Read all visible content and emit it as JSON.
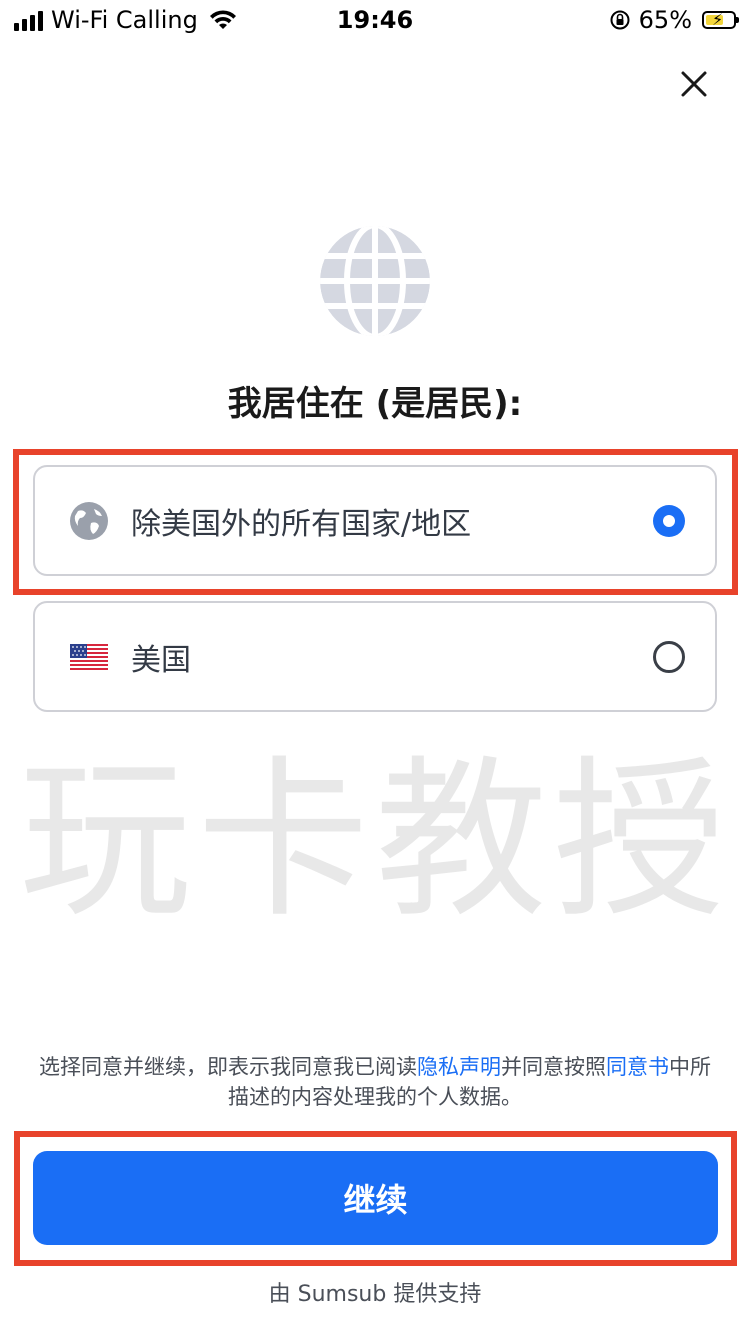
{
  "status_bar": {
    "carrier": "Wi-Fi Calling",
    "time": "19:46",
    "battery_percent": "65%",
    "battery_level": 0.65,
    "icons": [
      "signal-icon",
      "wifi-icon",
      "orientation-lock-icon",
      "battery-charging-icon"
    ]
  },
  "header": {
    "close_icon": "close-icon"
  },
  "hero": {
    "icon": "globe-icon",
    "title": "我居住在 (是居民):"
  },
  "options": [
    {
      "label": "除美国外的所有国家/地区",
      "icon": "globe-icon",
      "selected": true
    },
    {
      "label": "美国",
      "icon": "us-flag-icon",
      "selected": false
    }
  ],
  "watermark": "玩卡教授",
  "consent": {
    "text_before": "选择同意并继续，即表示我同意我已阅读",
    "privacy_link": "隐私声明",
    "text_middle": "并同意按照",
    "agreement_link": "同意书",
    "text_after": "中所描述的内容处理我的个人数据。"
  },
  "continue_button": "继续",
  "footer": "由 Sumsub 提供支持",
  "colors": {
    "accent": "#1a6ef5",
    "highlight": "#e8432b",
    "border": "#cfd0d6"
  }
}
